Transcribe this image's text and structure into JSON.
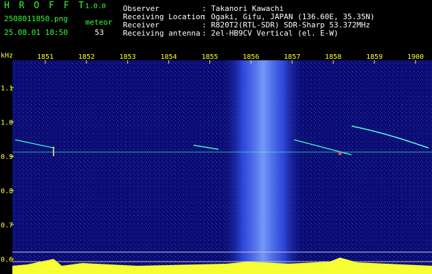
{
  "header": {
    "app_name": "H R O F F T",
    "version": "1.0.0",
    "filename": "2508011850.png",
    "meteor_label": "meteor",
    "datetime": "25.08.01 18:50",
    "meteor_count": "53"
  },
  "info": {
    "rows": [
      {
        "label": "Observer",
        "value": ": Takanori Kawachi"
      },
      {
        "label": "Receiving Location",
        "value": ": Ogaki, Gifu, JAPAN (136.60E, 35.35N)"
      },
      {
        "label": "Receiver",
        "value": ": R820T2(RTL-SDR) SDR-Sharp 53.372MHz"
      },
      {
        "label": "Receiving antenna",
        "value": ": 2el-HB9CV Vertical (el. E-W)"
      }
    ]
  },
  "chart_data": {
    "type": "heatmap",
    "ylabel": "kHz",
    "x_ticks": [
      "1851",
      "1852",
      "1853",
      "1854",
      "1855",
      "1856",
      "1857",
      "1858",
      "1859",
      "1900"
    ],
    "y_ticks": [
      "1.1",
      "1.0",
      "0.9",
      "0.8",
      "0.7",
      "0.6"
    ],
    "ylim": [
      0.58,
      1.18
    ],
    "carrier_khz": 0.92,
    "colors": {
      "background": "#0a0a6e",
      "noise_band": "#4a6cff",
      "signal": "#33ffcc",
      "ticks": "#ffff33"
    }
  }
}
